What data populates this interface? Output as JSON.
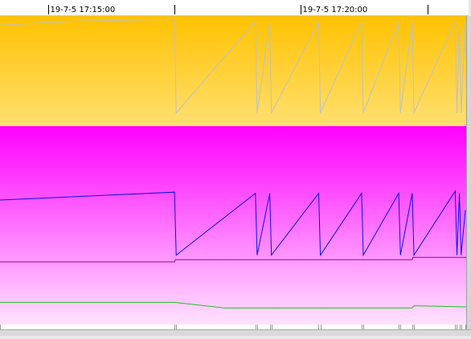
{
  "chart_data": {
    "type": "line",
    "time_axis": {
      "ticks": [
        {
          "time": "17:15:00",
          "label": "19-7-5 17:15:00"
        },
        {
          "time": "17:17:30",
          "label": ""
        },
        {
          "time": "17:20:00",
          "label": "19-7-5 17:20:00"
        },
        {
          "time": "17:22:30",
          "label": ""
        }
      ],
      "range": [
        "17:14:03",
        "17:23:16"
      ]
    },
    "panels": [
      {
        "name": "",
        "background_top": "#ffc200",
        "background_bottom": "#ffe070",
        "ylim": [
          0,
          100
        ],
        "series": [
          {
            "name": "",
            "color": "#c0c0c0",
            "points": [
              [
                "17:14:03",
                94
              ],
              [
                "17:15:30",
                98
              ],
              [
                "17:17:30",
                100
              ],
              [
                "17:17:32",
                6
              ],
              [
                "17:19:06",
                98
              ],
              [
                "17:19:08",
                6
              ],
              [
                "17:19:23",
                98
              ],
              [
                "17:19:25",
                6
              ],
              [
                "17:20:21",
                98
              ],
              [
                "17:20:23",
                6
              ],
              [
                "17:21:12",
                98
              ],
              [
                "17:21:14",
                6
              ],
              [
                "17:21:56",
                98
              ],
              [
                "17:21:58",
                6
              ],
              [
                "17:22:12",
                98
              ],
              [
                "17:22:14",
                6
              ],
              [
                "17:23:03",
                98
              ],
              [
                "17:23:05",
                6
              ],
              [
                "17:23:08",
                98
              ],
              [
                "17:23:10",
                6
              ],
              [
                "17:23:15",
                98
              ]
            ]
          }
        ]
      },
      {
        "name": "",
        "background_top": "#ff00ff",
        "background_bottom": "#ffe8ff",
        "ylim": [
          0,
          100
        ],
        "series": [
          {
            "name": "",
            "color": "#1010e0",
            "points": [
              [
                "17:14:03",
                55
              ],
              [
                "17:17:30",
                62
              ],
              [
                "17:17:32",
                6
              ],
              [
                "17:19:06",
                61
              ],
              [
                "17:19:08",
                6
              ],
              [
                "17:19:23",
                61
              ],
              [
                "17:19:25",
                6
              ],
              [
                "17:20:21",
                61
              ],
              [
                "17:20:23",
                6
              ],
              [
                "17:21:12",
                61
              ],
              [
                "17:21:14",
                6
              ],
              [
                "17:21:56",
                61
              ],
              [
                "17:21:58",
                6
              ],
              [
                "17:22:12",
                61
              ],
              [
                "17:22:14",
                6
              ],
              [
                "17:23:03",
                63
              ],
              [
                "17:23:05",
                6
              ],
              [
                "17:23:08",
                61
              ],
              [
                "17:23:10",
                6
              ],
              [
                "17:23:15",
                46
              ]
            ]
          },
          {
            "name": "",
            "color": "#a000a0",
            "points": [
              [
                "17:14:03",
                0
              ],
              [
                "17:17:30",
                0
              ],
              [
                "17:17:31",
                2
              ],
              [
                "17:22:12",
                2
              ],
              [
                "17:22:13",
                4
              ],
              [
                "17:23:16",
                4
              ]
            ]
          },
          {
            "name": "",
            "color": "#20c020",
            "points": [
              [
                "17:14:03",
                -36
              ],
              [
                "17:17:30",
                -36
              ],
              [
                "17:18:30",
                -41
              ],
              [
                "17:22:12",
                -41
              ],
              [
                "17:22:14",
                -39
              ],
              [
                "17:23:16",
                -40
              ]
            ]
          }
        ]
      }
    ],
    "grid": false,
    "legend": "none"
  }
}
